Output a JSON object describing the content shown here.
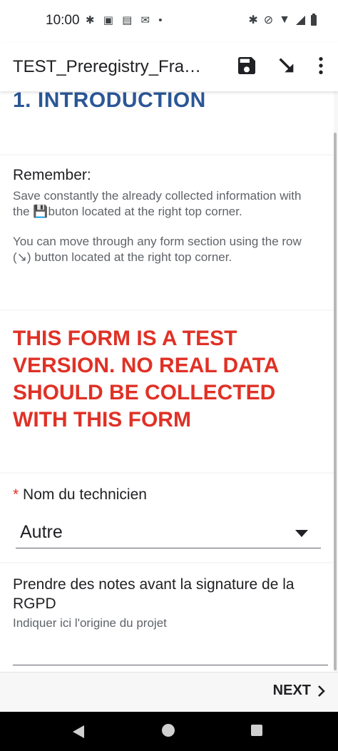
{
  "status_bar": {
    "time": "10:00",
    "left_icons": [
      "slack-icon",
      "teams-icon",
      "outlook-icon",
      "gmail-icon",
      "dot-icon"
    ],
    "right_icons": [
      "bluetooth-icon",
      "mute-icon",
      "wifi-icon",
      "signal-icon",
      "battery-icon"
    ]
  },
  "app_bar": {
    "title": "TEST_Preregistry_Fra…",
    "actions": [
      "save-icon",
      "goto-icon",
      "more-vert-icon"
    ]
  },
  "sections": {
    "intro_heading": "1. INTRODUCTION",
    "remember_title": "Remember:",
    "remember_text1": "Save constantly the already collected information with the 💾buton located at the right top corner.",
    "remember_text2": "You can move through any form section using the row (↘) button located at the right top corner.",
    "test_warning": "THIS FORM IS A TEST VERSION. NO REAL DATA SHOULD BE COLLECTED WITH THIS FORM"
  },
  "technician": {
    "required_mark": "*",
    "label": "Nom du technicien",
    "selected_value": "Autre"
  },
  "notes": {
    "label": "Prendre des notes avant la signature de la RGPD",
    "hint": "Indiquer ici l'origine du projet",
    "value": ""
  },
  "bottom_bar": {
    "next_label": "NEXT"
  },
  "colors": {
    "heading": "#2b5797",
    "warning": "#e03126",
    "text": "#202124",
    "muted": "#5f6368"
  }
}
